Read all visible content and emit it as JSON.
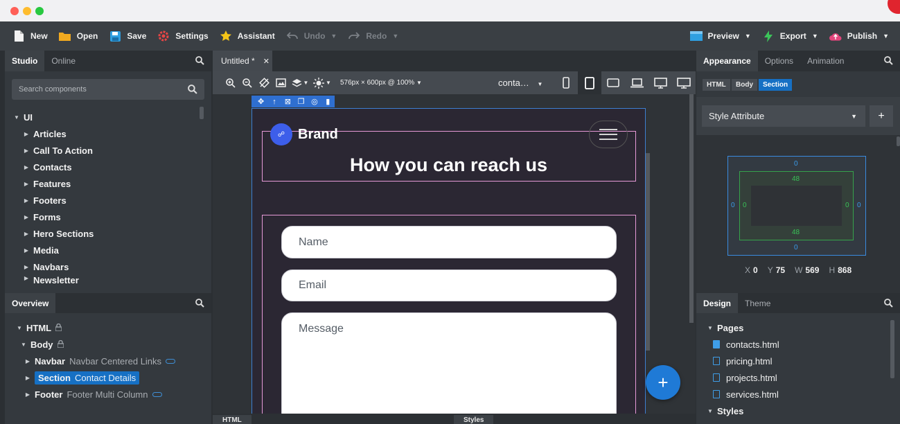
{
  "toolbar": {
    "new": "New",
    "open": "Open",
    "save": "Save",
    "settings": "Settings",
    "assistant": "Assistant",
    "undo": "Undo",
    "redo": "Redo",
    "preview": "Preview",
    "export": "Export",
    "publish": "Publish"
  },
  "left": {
    "tabs": [
      "Studio",
      "Online"
    ],
    "search_placeholder": "Search components",
    "tree_root": "UI",
    "components": [
      "Articles",
      "Call To Action",
      "Contacts",
      "Features",
      "Footers",
      "Forms",
      "Hero Sections",
      "Media",
      "Navbars",
      "Newsletter"
    ]
  },
  "overview": {
    "tab": "Overview",
    "html": "HTML",
    "body": "Body",
    "navbar": {
      "name": "Navbar",
      "desc": "Navbar Centered Links"
    },
    "section": {
      "name": "Section",
      "desc": "Contact Details"
    },
    "footer": {
      "name": "Footer",
      "desc": "Footer Multi Column"
    }
  },
  "editor": {
    "doc_tab": "Untitled *",
    "size_label": "576px × 600px @ 100%",
    "context": "conta…",
    "brand": "Brand",
    "heading": "How you can reach us",
    "name_placeholder": "Name",
    "email_placeholder": "Email",
    "message_placeholder": "Message",
    "bottom_tabs": [
      "HTML",
      "Styles"
    ]
  },
  "right": {
    "tabs": [
      "Appearance",
      "Options",
      "Animation"
    ],
    "breadcrumb": [
      "HTML",
      "Body",
      "Section"
    ],
    "style_attribute": "Style Attribute",
    "box_model": {
      "margin_top": "0",
      "margin_bottom": "0",
      "margin_left": "0",
      "margin_right": "0",
      "padding_top": "48",
      "padding_bottom": "48",
      "padding_left": "0",
      "padding_right": "0"
    },
    "dims": {
      "x_label": "X",
      "x": "0",
      "y_label": "Y",
      "y": "75",
      "w_label": "W",
      "w": "569",
      "h_label": "H",
      "h": "868"
    },
    "design_tabs": [
      "Design",
      "Theme"
    ],
    "pages_label": "Pages",
    "pages": [
      "contacts.html",
      "pricing.html",
      "projects.html",
      "services.html"
    ],
    "styles_label": "Styles"
  },
  "colors": {
    "accent": "#1670c4",
    "selection": "#3d7fd1",
    "outline": "#e79ad8",
    "fab": "#1f7ad6"
  }
}
